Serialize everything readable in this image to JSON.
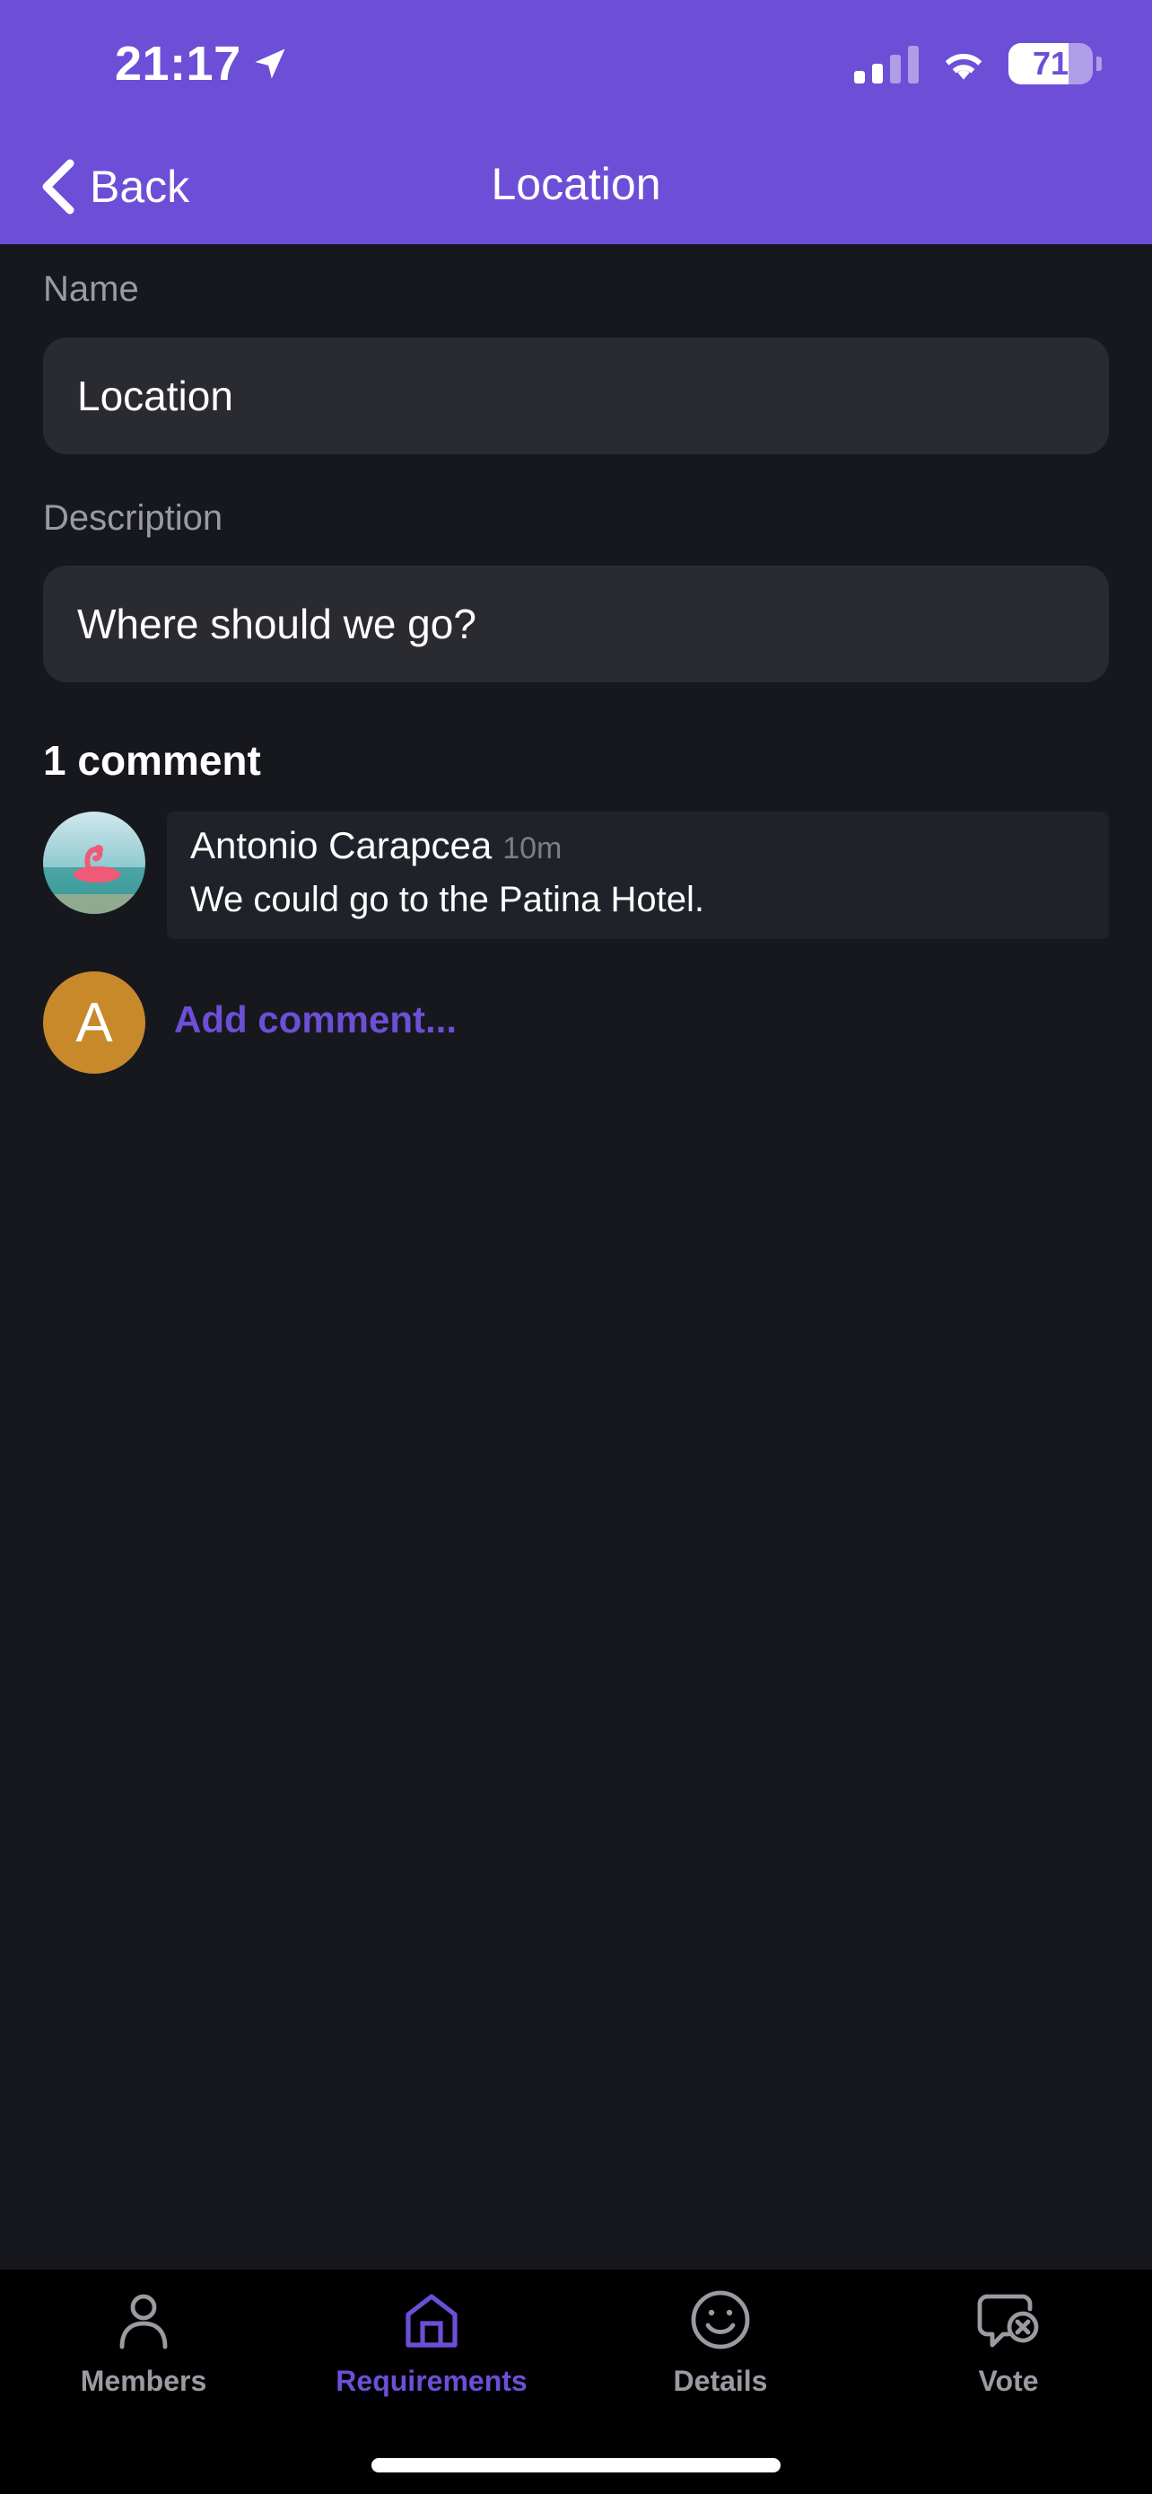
{
  "status_bar": {
    "time": "21:17",
    "battery": "71",
    "battery_fraction": 0.71
  },
  "header": {
    "back_label": "Back",
    "title": "Location"
  },
  "form": {
    "name_label": "Name",
    "name_value": "Location",
    "description_label": "Description",
    "description_value": "Where should we go?"
  },
  "comments": {
    "count_label": "1 comment",
    "items": [
      {
        "author": "Antonio Carapcea",
        "time": "10m",
        "text": "We could go to the Patina Hotel."
      }
    ],
    "current_user_initial": "A",
    "add_placeholder": "Add comment..."
  },
  "tabs": [
    {
      "label": "Members",
      "icon": "person-icon",
      "active": false
    },
    {
      "label": "Requirements",
      "icon": "home-icon",
      "active": true
    },
    {
      "label": "Details",
      "icon": "smiley-icon",
      "active": false
    },
    {
      "label": "Vote",
      "icon": "chat-bubble-x-icon",
      "active": false
    }
  ],
  "colors": {
    "accent": "#6c4fd6",
    "background": "#17181d",
    "field": "#2a2b30",
    "avatar": "#c8892a"
  }
}
